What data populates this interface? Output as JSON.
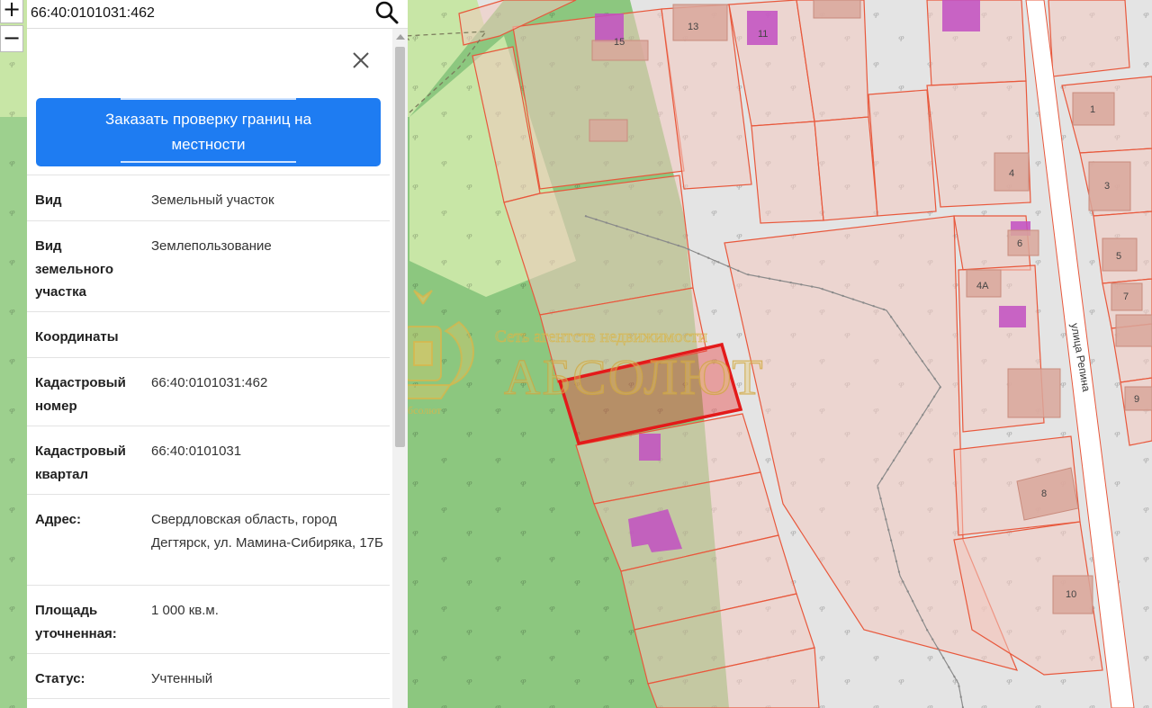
{
  "search": {
    "value": "66:40:0101031:462"
  },
  "zoom": {
    "in_label": "+",
    "out_label": "−"
  },
  "panel": {
    "order_button_label": "Заказать проверку границ на местности",
    "properties": [
      {
        "label": "Вид",
        "value": "Земельный участок"
      },
      {
        "label": "Вид земельного участка",
        "value": "Землепользование"
      },
      {
        "label": "Координаты",
        "value": ""
      },
      {
        "label": "Кадастровый номер",
        "value": "66:40:0101031:462"
      },
      {
        "label": "Кадастровый квартал",
        "value": "66:40:0101031"
      },
      {
        "label": "Адрес:",
        "value": "Свердловская область, город Дегтярск, ул. Мамина-Сибиряка, 17Б"
      },
      {
        "label": "Площадь уточненная:",
        "value": "1 000 кв.м."
      },
      {
        "label": "Статус:",
        "value": "Учтенный"
      }
    ]
  },
  "map": {
    "street_label": "улица Репина",
    "house_numbers": [
      "15",
      "13",
      "11",
      "1",
      "4",
      "3",
      "6",
      "5",
      "4А",
      "7",
      "9",
      "8",
      "10"
    ],
    "colors": {
      "parcel_fill": "#f2c8c0",
      "parcel_border": "#e8583c",
      "selected_border": "#e31a1a",
      "building": "#c24fc2",
      "forest": "#8cc77f",
      "meadow": "#c8e6a6",
      "road": "#e1e1e1"
    }
  },
  "watermark": {
    "top_text": "Сеть агентств недвижимости",
    "brand_text": "АБСОЛЮТ",
    "emblem_text": "Абсолют"
  }
}
